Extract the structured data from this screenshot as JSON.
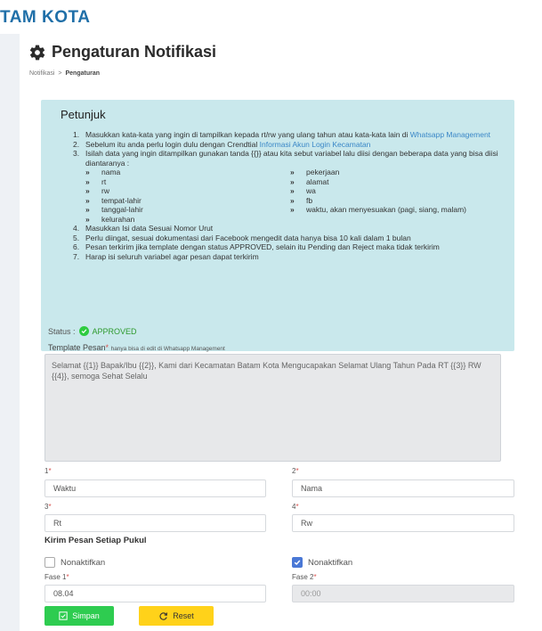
{
  "brand": {
    "text": "TAM KOTA"
  },
  "page": {
    "title": "Pengaturan Notifikasi",
    "breadcrumb": {
      "parent": "Notifikasi",
      "separator": ">",
      "current": "Pengaturan"
    }
  },
  "info": {
    "title": "Petunjuk",
    "steps": [
      {
        "num": "1.",
        "text": "Masukkan kata-kata yang ingin di tampilkan kepada rt/rw yang ulang tahun atau kata-kata lain di ",
        "link": "Whatsapp Management"
      },
      {
        "num": "2.",
        "text": "Sebelum itu anda perlu login dulu dengan Crendtial ",
        "link": "Informasi Akun Login Kecamatan"
      },
      {
        "num": "3.",
        "text": "Isilah data yang ingin ditampilkan gunakan tanda {{}} atau kita sebut variabel lalu diisi dengan beberapa data yang bisa diisi diantaranya :"
      },
      {
        "num": "4.",
        "text": "Masukkan Isi data Sesuai Nomor Urut"
      },
      {
        "num": "5.",
        "text": "Perlu diingat, sesuai dokumentasi dari Facebook mengedit data hanya bisa 10 kali dalam 1 bulan"
      },
      {
        "num": "6.",
        "text": "Pesan terkirim jika template dengan status APPROVED, selain itu Pending dan Reject maka tidak terkirim"
      },
      {
        "num": "7.",
        "text": "Harap isi seluruh variabel agar pesan dapat terkirim"
      }
    ],
    "chev": "»",
    "variables": [
      "nama",
      "pekerjaan",
      "rt",
      "alamat",
      "rw",
      "wa",
      "tempat-lahir",
      "fb",
      "tanggal-lahir",
      "waktu, akan menyesuakan (pagi, siang, malam)",
      "kelurahan"
    ]
  },
  "status": {
    "label": "Status :",
    "value": "APPROVED"
  },
  "template": {
    "label": "Template Pesan",
    "required": "*",
    "note": "hanya bisa di edit di Whatsapp Management",
    "text": "Selamat {{1}} Bapak/Ibu {{2}}, Kami dari Kecamatan Batam Kota Mengucapakan Selamat Ulang Tahun Pada RT {{3}} RW {{4}}, semoga Sehat Selalu"
  },
  "fields": {
    "f1": {
      "label": "1",
      "value": "Waktu"
    },
    "f2": {
      "label": "2",
      "value": "Nama"
    },
    "f3": {
      "label": "3",
      "value": "Rt"
    },
    "f4": {
      "label": "4",
      "value": "Rw"
    }
  },
  "schedule": {
    "title": "Kirim Pesan Setiap Pukul",
    "left_toggle": "Nonaktifkan",
    "right_toggle": "Nonaktifkan",
    "fase1": {
      "label": "Fase 1",
      "value": "08.04"
    },
    "fase2": {
      "label": "Fase 2",
      "value": "00:00"
    }
  },
  "buttons": {
    "save": "Simpan",
    "reset": "Reset"
  },
  "colors": {
    "brand": "#1f6fa8",
    "info_bg": "#c9e8ec",
    "save": "#2ecc50",
    "reset": "#ffd21a",
    "approved": "#2ecc40",
    "checkbox_on": "#4a78d6"
  }
}
